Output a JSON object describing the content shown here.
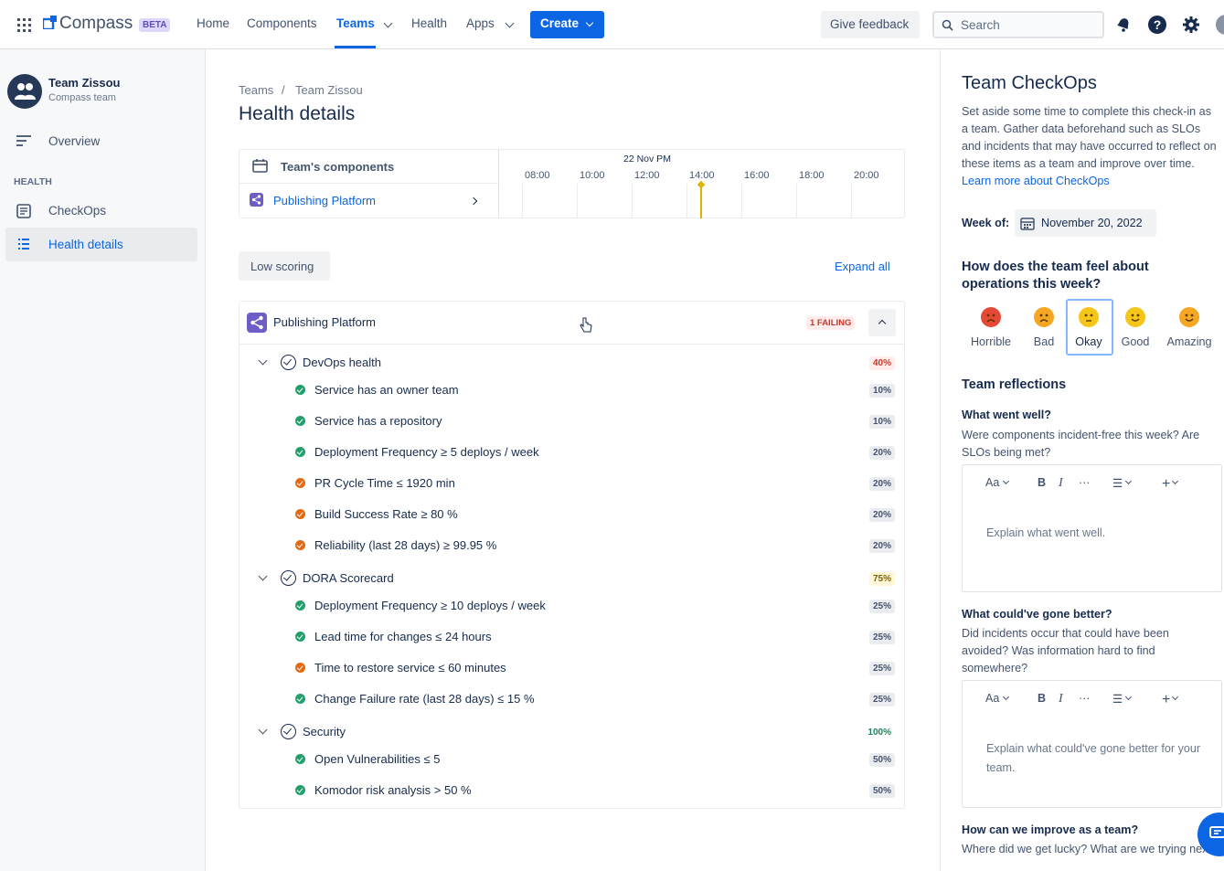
{
  "nav": {
    "brand": "Compass",
    "beta": "BETA",
    "home": "Home",
    "components": "Components",
    "teams": "Teams",
    "health": "Health",
    "apps": "Apps",
    "create": "Create",
    "feedback": "Give feedback",
    "search_placeholder": "Search"
  },
  "sidebar": {
    "team_name": "Team Zissou",
    "team_sub": "Compass team",
    "overview": "Overview",
    "section": "HEALTH",
    "checkops": "CheckOps",
    "health_details": "Health details"
  },
  "main": {
    "crumb_teams": "Teams",
    "crumb_sep": "/",
    "crumb_team": "Team Zissou",
    "title": "Health details",
    "components_header": "Team's components",
    "component": "Publishing Platform",
    "timeline_date": "22 Nov PM",
    "hours": [
      "08:00",
      "10:00",
      "12:00",
      "14:00",
      "16:00",
      "18:00",
      "20:00"
    ],
    "filter": "Low scoring",
    "expand_all": "Expand all",
    "card_title": "Publishing Platform",
    "failing": "1 FAILING",
    "groups": [
      {
        "name": "DevOps health",
        "pct": "40%",
        "items": [
          {
            "label": "Service has an owner team",
            "pct": "10%",
            "status": "pass"
          },
          {
            "label": "Service has a repository",
            "pct": "10%",
            "status": "pass"
          },
          {
            "label": "Deployment Frequency ≥ 5 deploys / week",
            "pct": "20%",
            "status": "pass"
          },
          {
            "label": "PR Cycle Time ≤ 1920 min",
            "pct": "20%",
            "status": "fail"
          },
          {
            "label": "Build Success Rate ≥ 80 %",
            "pct": "20%",
            "status": "fail"
          },
          {
            "label": "Reliability (last 28 days) ≥ 99.95 %",
            "pct": "20%",
            "status": "fail"
          }
        ]
      },
      {
        "name": "DORA Scorecard",
        "pct": "75%",
        "items": [
          {
            "label": "Deployment Frequency ≥ 10 deploys / week",
            "pct": "25%",
            "status": "pass"
          },
          {
            "label": "Lead time for changes ≤ 24 hours",
            "pct": "25%",
            "status": "pass"
          },
          {
            "label": "Time to restore service ≤ 60 minutes",
            "pct": "25%",
            "status": "fail"
          },
          {
            "label": "Change Failure rate (last 28 days) ≤ 15 %",
            "pct": "25%",
            "status": "pass"
          }
        ]
      },
      {
        "name": "Security",
        "pct": "100%",
        "items": [
          {
            "label": "Open Vulnerabilities ≤ 5",
            "pct": "50%",
            "status": "pass"
          },
          {
            "label": "Komodor risk analysis > 50 %",
            "pct": "50%",
            "status": "pass"
          }
        ]
      }
    ]
  },
  "panel": {
    "title": "Team CheckOps",
    "intro": "Set aside some time to complete this check-in as a team. Gather data beforehand such as SLOs and incidents that may have occurred to reflect on these items as a team and improve over time.",
    "learn_more": "Learn more about CheckOps",
    "week_label": "Week of:",
    "week_value": "November 20, 2022",
    "question": "How does the team feel about operations this week?",
    "moods": [
      "Horrible",
      "Bad",
      "Okay",
      "Good",
      "Amazing"
    ],
    "reflections": "Team reflections",
    "q1": "What went well?",
    "q1_desc": "Were components incident-free this week? Are SLOs being met?",
    "q1_placeholder": "Explain what went well.",
    "q2": "What could've gone better?",
    "q2_desc": "Did incidents occur that could have been avoided? Was information hard to find somewhere?",
    "q2_placeholder": "Explain what could've gone better for your team.",
    "q3": "How can we improve as a team?",
    "q3_desc": "Where did we get lucky? What are we trying next?",
    "toolbar": {
      "font": "Aa",
      "bold": "B",
      "italic": "I",
      "more": "···",
      "list": "☰",
      "add": "+"
    }
  },
  "colors": {
    "accent": "#0c66e4",
    "pass": "#22a06b",
    "fail": "#e56910"
  }
}
